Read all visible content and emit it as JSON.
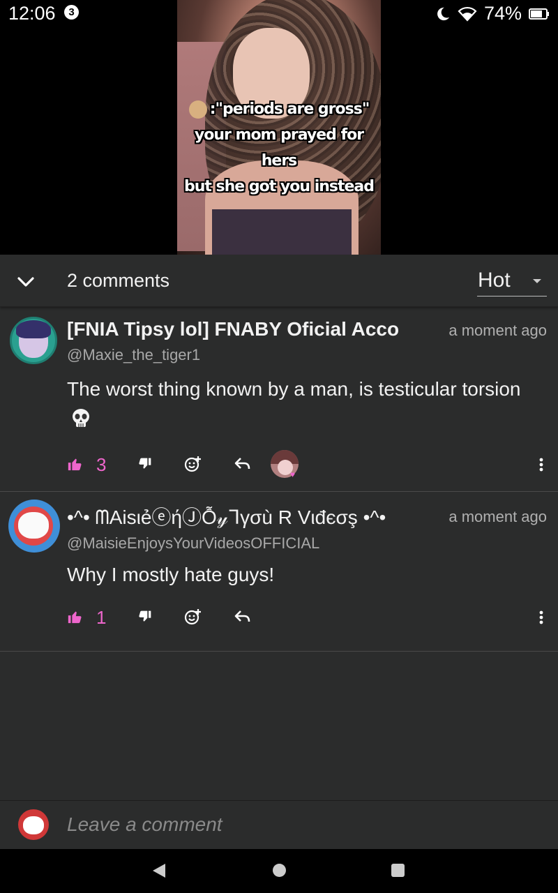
{
  "status_bar": {
    "time": "12:06",
    "notification_count": "3",
    "battery": "74%",
    "icons": [
      "moon-icon",
      "wifi-icon",
      "battery-icon"
    ]
  },
  "video": {
    "caption_line1": ":\"periods are gross\"",
    "caption_line2": "your mom prayed for hers",
    "caption_line3": "but she got you instead"
  },
  "comments_header": {
    "count_label": "2 comments",
    "sort_selected": "Hot"
  },
  "comments": [
    {
      "author": "[FNIA Tipsy lol] FNABY Oficial Acco",
      "handle": "@Maxie_the_tiger1",
      "timestamp": "a moment ago",
      "body": "The worst thing known by a man, is testicular torsion",
      "likes": "3",
      "has_creator_heart": true
    },
    {
      "author": "•^• ᗰAisιẻⓔήⒿỖ𝓎ᒣγσù R Vιđєσş •^•",
      "handle": "@MaisieEnjoysYourVideosOFFICIAL",
      "timestamp": "a moment ago",
      "body": "Why I mostly hate guys!",
      "likes": "1",
      "has_creator_heart": false
    }
  ],
  "leave_comment": {
    "placeholder": "Leave a comment"
  },
  "colors": {
    "panel_bg": "#2b2c2c",
    "like_accent": "#ee66cc",
    "text_primary": "#f2f2f2",
    "text_secondary": "#a8a8a8"
  }
}
